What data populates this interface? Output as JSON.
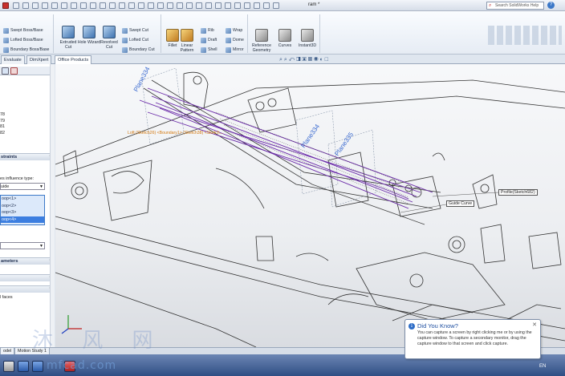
{
  "window": {
    "title": "ram *",
    "search_placeholder": "Search SolidWorks Help",
    "help_label": "?"
  },
  "ribbon": {
    "features_col1": [
      "Swept Boss/Base",
      "Lofted Boss/Base",
      "Boundary Boss/Base"
    ],
    "big_buttons_1": [
      {
        "label": "Extruded Cut"
      },
      {
        "label": "Hole Wizard"
      },
      {
        "label": "Revolved Cut"
      }
    ],
    "features_col2": [
      "Swept Cut",
      "Lofted Cut",
      "Boundary Cut"
    ],
    "big_buttons_2": [
      {
        "label": "Fillet"
      },
      {
        "label": "Linear Pattern"
      }
    ],
    "features_col3": [
      "Rib",
      "Draft",
      "Shell"
    ],
    "features_col4": [
      "Wrap",
      "Dome",
      "Mirror"
    ],
    "big_buttons_3": [
      {
        "label": "Reference Geometry"
      },
      {
        "label": "Curves"
      },
      {
        "label": "Instant3D"
      }
    ]
  },
  "command_tabs": [
    "Evaluate",
    "DimXpert",
    "Office Products"
  ],
  "feature_manager": {
    "items": [
      "78",
      "79",
      "81",
      "82"
    ],
    "constraints_header": "straints",
    "influence_label": "es influence type:",
    "influence_value": "uide",
    "loops": [
      "oop<1>",
      "oop<2>",
      "oop<3>",
      "oop<4>"
    ],
    "parameters_header": "ameters",
    "faces_label": "l faces"
  },
  "graphics": {
    "breadcrumb": "Loft (Sketch26) <Boundary1> (Sketch38) <Sketch...",
    "plane_labels": [
      "Plane334",
      "Plane334",
      "Plane335"
    ],
    "callouts": {
      "profile": "Profile(Sketch682)",
      "guide": "Guide Curve"
    }
  },
  "bottom_tabs": [
    "odel",
    "Motion Study 1"
  ],
  "did_you_know": {
    "title": "Did You Know?",
    "body": "You can capture a screen by right clicking me or by using the capture window. To capture a secondary monitor, drag the capture window to that screen and click capture."
  },
  "taskbar": {
    "lang": "EN"
  },
  "watermark": {
    "cn": "沐 风 网",
    "url": "mfcad.com"
  },
  "colors": {
    "accent_blue": "#3c7ee0",
    "purple_curves": "#6a2aa8",
    "plane_text": "#3a6ad0",
    "breadcrumb": "#d47a10"
  }
}
